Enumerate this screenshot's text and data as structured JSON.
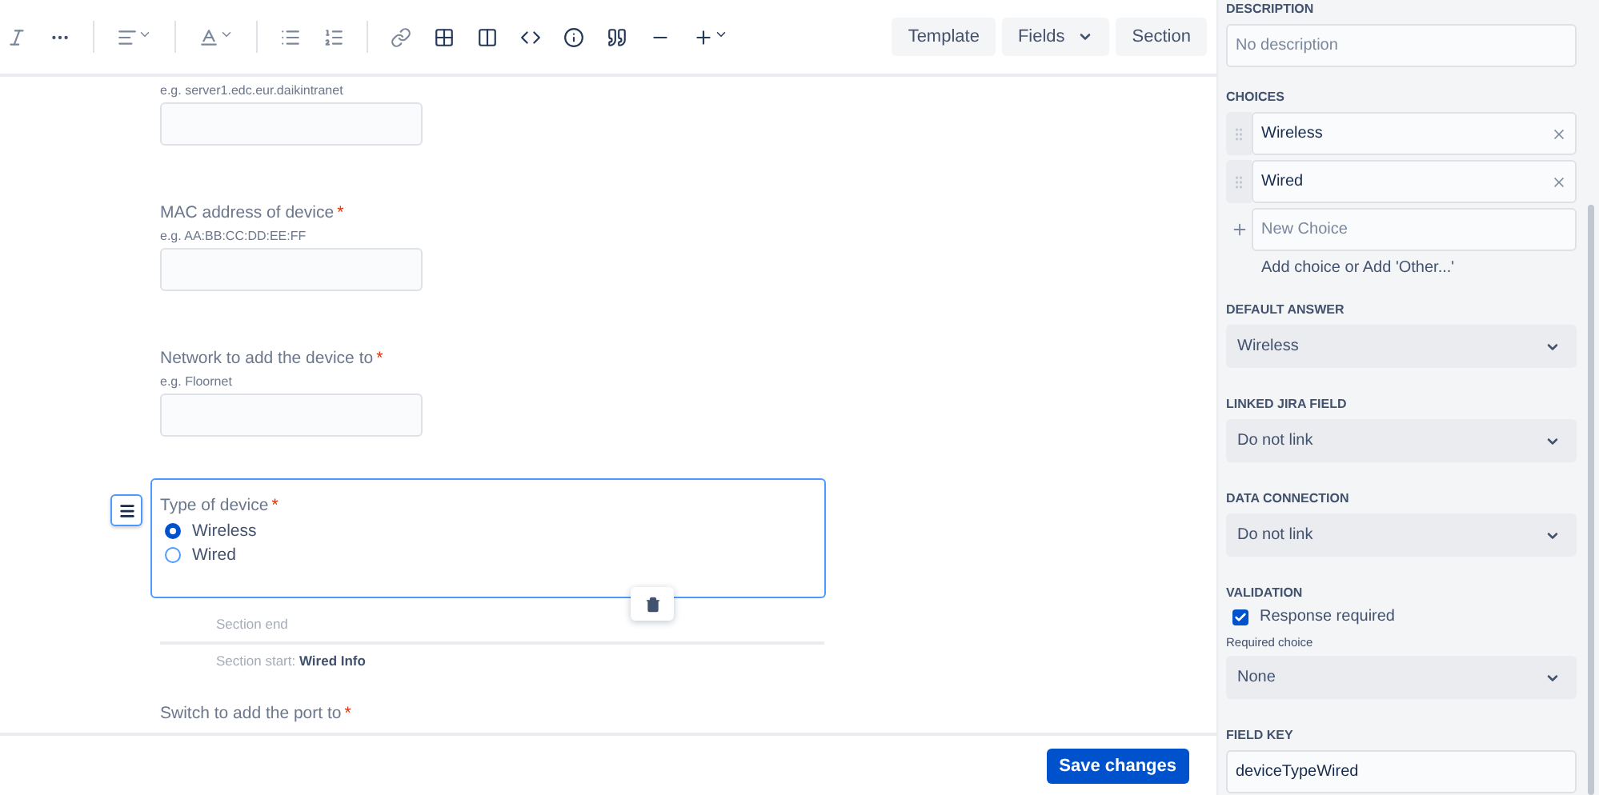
{
  "toolbar": {
    "buttons": [
      {
        "label": "Template",
        "dropdown": false
      },
      {
        "label": "Fields",
        "dropdown": true
      },
      {
        "label": "Section",
        "dropdown": false
      }
    ]
  },
  "form": {
    "fields": [
      {
        "kind": "text",
        "hint": "e.g. server1.edc.eur.daikintranet"
      },
      {
        "kind": "text",
        "label": "MAC address of device",
        "required_mark": "*",
        "hint": "e.g. AA:BB:CC:DD:EE:FF"
      },
      {
        "kind": "text",
        "label": "Network to add the device to",
        "required_mark": "*",
        "hint": "e.g. Floornet"
      },
      {
        "kind": "radio",
        "label": "Type of device",
        "required_mark": "*",
        "active": true,
        "options": [
          {
            "label": "Wireless",
            "selected": true
          },
          {
            "label": "Wired",
            "selected": false
          }
        ]
      },
      {
        "kind": "section",
        "end_label": "Section end",
        "start_label": "Section start: **Wired Info**"
      },
      {
        "kind": "heading",
        "label": "Switch to add the port to",
        "required_mark": "*"
      }
    ]
  },
  "panel": {
    "description": {
      "label": "DESCRIPTION",
      "placeholder": "No description"
    },
    "choices": {
      "label": "CHOICES",
      "items": [
        {
          "label": "Wireless"
        },
        {
          "label": "Wired"
        }
      ],
      "new_placeholder": "New Choice",
      "add_link": "Add choice or Add 'Other...'"
    },
    "selects": [
      {
        "label": "DEFAULT ANSWER",
        "value": "Wireless"
      },
      {
        "label": "LINKED JIRA FIELD",
        "value": "Do not link"
      },
      {
        "label": "DATA CONNECTION",
        "value": "Do not link"
      }
    ],
    "validation": {
      "label": "VALIDATION",
      "checkbox": {
        "label": "Response required",
        "checked": true
      },
      "required_choice": {
        "label": "Required choice",
        "value": "None"
      }
    },
    "field_key": {
      "label": "FIELD KEY",
      "value": "deviceTypeWired"
    }
  },
  "footer": {
    "save": "Save changes"
  }
}
